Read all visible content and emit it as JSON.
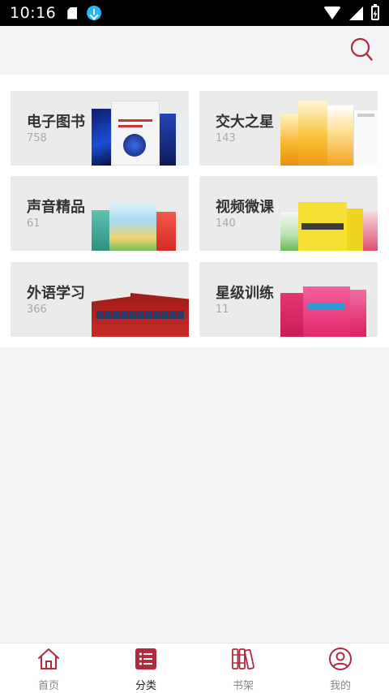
{
  "status_bar": {
    "time": "10:16"
  },
  "categories": [
    {
      "title": "电子图书",
      "count": "758"
    },
    {
      "title": "交大之星",
      "count": "143"
    },
    {
      "title": "声音精品",
      "count": "61"
    },
    {
      "title": "视频微课",
      "count": "140"
    },
    {
      "title": "外语学习",
      "count": "366"
    },
    {
      "title": "星级训练",
      "count": "11"
    }
  ],
  "nav": [
    {
      "label": "首页",
      "icon": "home-icon"
    },
    {
      "label": "分类",
      "icon": "category-list-icon",
      "active": true
    },
    {
      "label": "书架",
      "icon": "bookshelf-icon"
    },
    {
      "label": "我的",
      "icon": "profile-icon"
    }
  ],
  "colors": {
    "accent": "#b22a3e",
    "card_bg": "#ebebeb",
    "page_bg": "#f4f4f6"
  }
}
